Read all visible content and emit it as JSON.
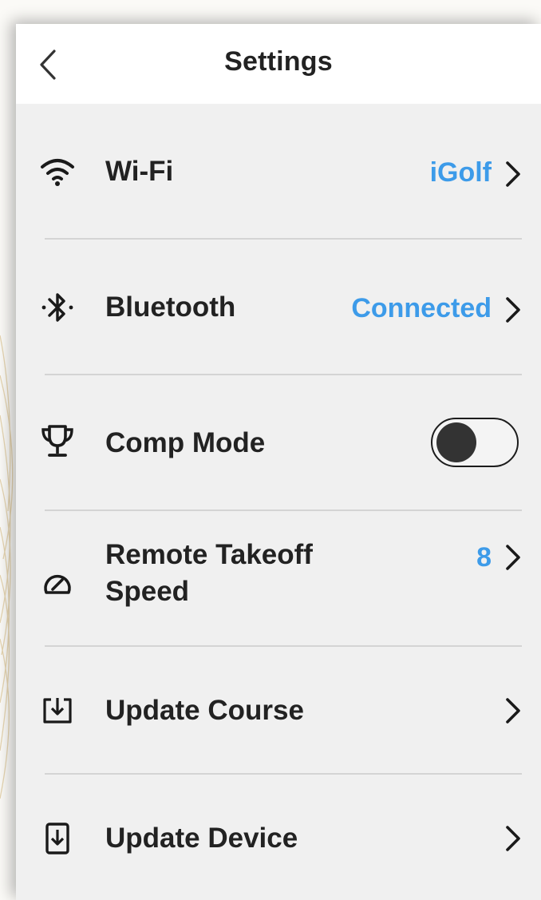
{
  "header": {
    "title": "Settings",
    "back_icon": "chevron-left-icon"
  },
  "colors": {
    "accent": "#3d9be9",
    "text": "#222222",
    "background": "#f0f0f0",
    "divider": "#d4d4d4"
  },
  "settings": {
    "wifi": {
      "label": "Wi-Fi",
      "value": "iGolf",
      "icon": "wifi-icon"
    },
    "bluetooth": {
      "label": "Bluetooth",
      "value": "Connected",
      "icon": "bluetooth-icon"
    },
    "comp_mode": {
      "label": "Comp Mode",
      "icon": "trophy-icon",
      "enabled": false
    },
    "remote_speed": {
      "label_line1": "Remote Takeoff",
      "label_line2": "Speed",
      "value": "8",
      "icon": "speedometer-icon"
    },
    "update_course": {
      "label": "Update Course",
      "icon": "download-box-icon"
    },
    "update_device": {
      "label": "Update Device",
      "icon": "device-download-icon"
    }
  }
}
